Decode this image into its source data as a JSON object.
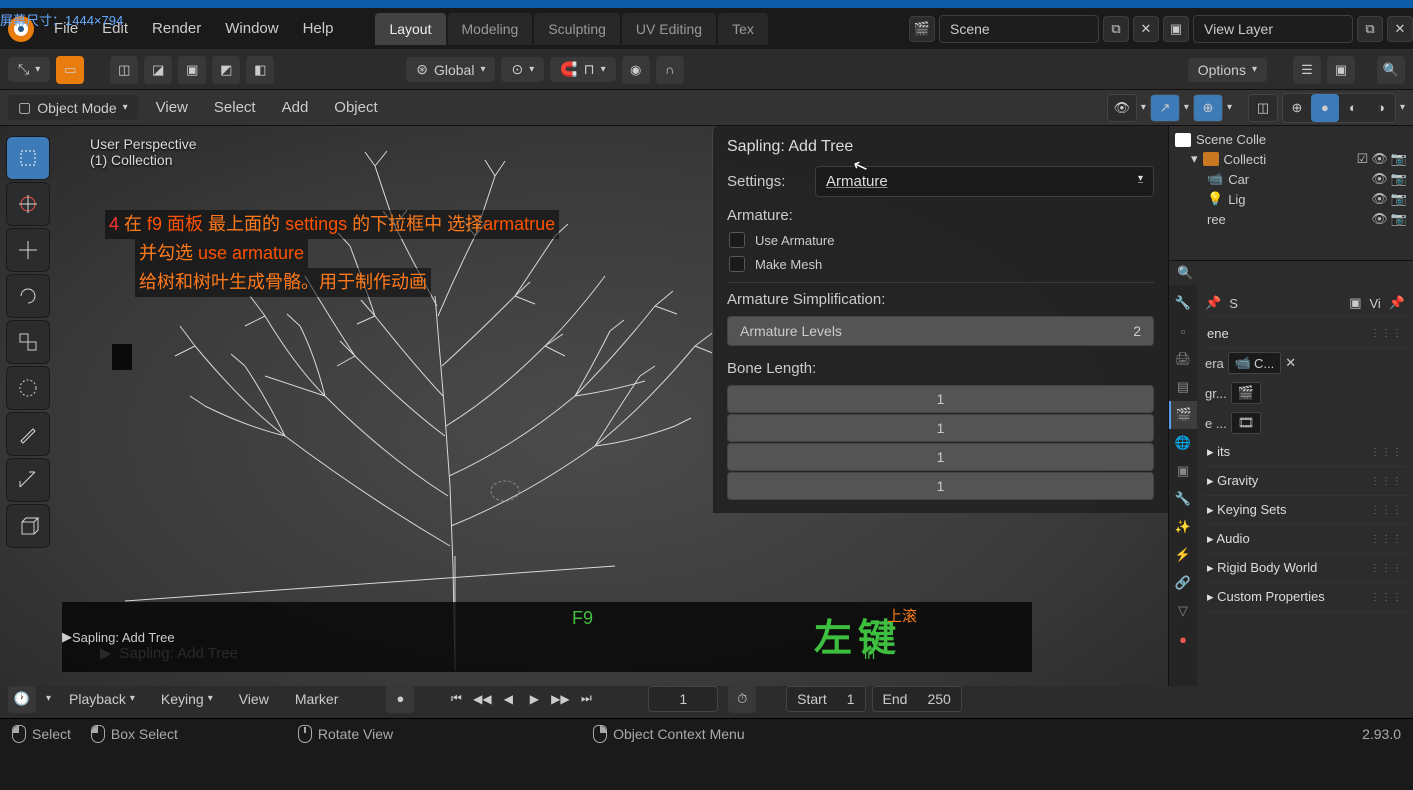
{
  "screen_dims": "屏幕尺寸：1444×794",
  "menubar": [
    "File",
    "Edit",
    "Render",
    "Window",
    "Help"
  ],
  "workspace_tabs": [
    {
      "label": "Layout",
      "active": true
    },
    {
      "label": "Modeling",
      "active": false
    },
    {
      "label": "Sculpting",
      "active": false
    },
    {
      "label": "UV Editing",
      "active": false
    },
    {
      "label": "Tex",
      "active": false
    }
  ],
  "scene_name": "Scene",
  "view_layer": "View Layer",
  "transform_orientation": "Global",
  "options_label": "Options",
  "mode_label": "Object Mode",
  "header_menus": [
    "View",
    "Select",
    "Add",
    "Object"
  ],
  "view_info": {
    "perspective": "User Perspective",
    "collection": "(1) Collection"
  },
  "annotation": {
    "num": "4",
    "line1_a": "  在 ",
    "line1_b": "f9 面板",
    "line1_c": "  最上面的 ",
    "line1_d": "settings",
    "line1_e": "  的下拉框中 选择",
    "line1_f": "armatrue",
    "line2_a": "并勾选 ",
    "line2_b": "use armature",
    "line3": "给树和树叶生成骨骼。用于制作动画"
  },
  "key_overlay": {
    "f9": "F9",
    "left": "左键",
    "scroll": "上滚",
    "in": "in"
  },
  "redo_panel": "Sapling: Add Tree",
  "sapling": {
    "title": "Sapling: Add Tree",
    "settings_label": "Settings:",
    "settings_value": "Armature",
    "armature_section": "Armature:",
    "use_armature": "Use Armature",
    "make_mesh": "Make Mesh",
    "simplification": "Armature Simplification:",
    "armature_levels_label": "Armature Levels",
    "armature_levels_value": "2",
    "bone_length": "Bone Length:",
    "bone_values": [
      "1",
      "1",
      "1",
      "1"
    ]
  },
  "outliner": {
    "scene_coll": "Scene Colle",
    "collection": "Collecti",
    "items": [
      "Car",
      "Lig",
      "ree"
    ]
  },
  "properties": {
    "search_ph": "",
    "selected": "S",
    "vi": "Vi",
    "header_item": "ene",
    "camera_label": "era",
    "camera_obj": "C...",
    "bg_label": "gr...",
    "active_label": "e ...",
    "panels": [
      "its",
      "Gravity",
      "Keying Sets",
      "Audio",
      "Rigid Body World",
      "Custom Properties"
    ]
  },
  "timeline": {
    "playback": "Playback",
    "keying": "Keying",
    "view": "View",
    "marker": "Marker",
    "current_frame": "1",
    "start_label": "Start",
    "start_val": "1",
    "end_label": "End",
    "end_val": "250"
  },
  "statusbar": {
    "select": "Select",
    "box_select": "Box Select",
    "rotate": "Rotate View",
    "context": "Object Context Menu",
    "version": "2.93.0"
  }
}
